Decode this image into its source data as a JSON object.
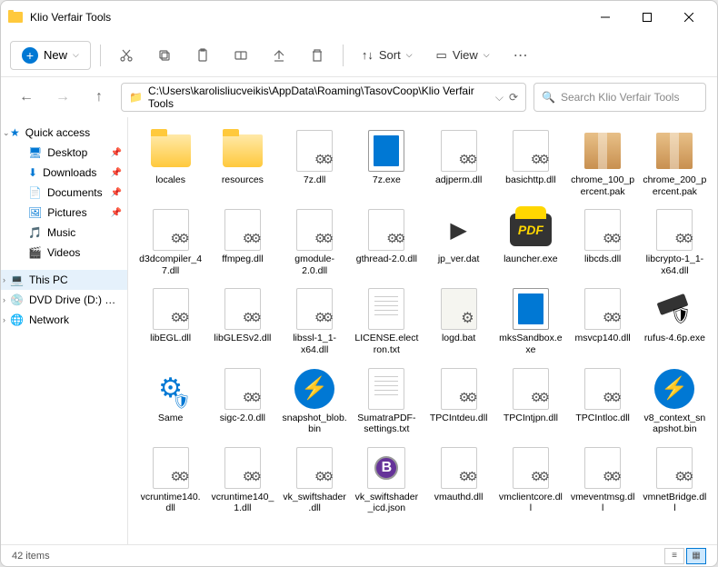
{
  "title": "Klio Verfair Tools",
  "toolbar": {
    "new": "New",
    "sort": "Sort",
    "view": "View"
  },
  "path": "C:\\Users\\karolisliucveikis\\AppData\\Roaming\\TasovCoop\\Klio Verfair Tools",
  "search_placeholder": "Search Klio Verfair Tools",
  "sidebar": {
    "quickaccess": "Quick access",
    "desktop": "Desktop",
    "downloads": "Downloads",
    "documents": "Documents",
    "pictures": "Pictures",
    "music": "Music",
    "videos": "Videos",
    "thispc": "This PC",
    "dvd": "DVD Drive (D:) CCCC",
    "network": "Network"
  },
  "files": [
    {
      "name": "locales",
      "type": "folder"
    },
    {
      "name": "resources",
      "type": "folder"
    },
    {
      "name": "7z.dll",
      "type": "dll"
    },
    {
      "name": "7z.exe",
      "type": "exe-blue"
    },
    {
      "name": "adjperm.dll",
      "type": "dll"
    },
    {
      "name": "basichttp.dll",
      "type": "dll"
    },
    {
      "name": "chrome_100_percent.pak",
      "type": "pak"
    },
    {
      "name": "chrome_200_percent.pak",
      "type": "pak"
    },
    {
      "name": "d3dcompiler_47.dll",
      "type": "dll"
    },
    {
      "name": "ffmpeg.dll",
      "type": "dll"
    },
    {
      "name": "gmodule-2.0.dll",
      "type": "dll"
    },
    {
      "name": "gthread-2.0.dll",
      "type": "dll"
    },
    {
      "name": "jp_ver.dat",
      "type": "play"
    },
    {
      "name": "launcher.exe",
      "type": "pdf"
    },
    {
      "name": "libcds.dll",
      "type": "dll"
    },
    {
      "name": "libcrypto-1_1-x64.dll",
      "type": "dll"
    },
    {
      "name": "libEGL.dll",
      "type": "dll"
    },
    {
      "name": "libGLESv2.dll",
      "type": "dll"
    },
    {
      "name": "libssl-1_1-x64.dll",
      "type": "dll"
    },
    {
      "name": "LICENSE.electron.txt",
      "type": "txt"
    },
    {
      "name": "logd.bat",
      "type": "bat"
    },
    {
      "name": "mksSandbox.exe",
      "type": "exe-blue"
    },
    {
      "name": "msvcp140.dll",
      "type": "dll"
    },
    {
      "name": "rufus-4.6p.exe",
      "type": "usb"
    },
    {
      "name": "Same",
      "type": "gear-shield"
    },
    {
      "name": "sigc-2.0.dll",
      "type": "dll"
    },
    {
      "name": "snapshot_blob.bin",
      "type": "bolt"
    },
    {
      "name": "SumatraPDF-settings.txt",
      "type": "txt"
    },
    {
      "name": "TPCIntdeu.dll",
      "type": "dll"
    },
    {
      "name": "TPCIntjpn.dll",
      "type": "dll"
    },
    {
      "name": "TPCIntloc.dll",
      "type": "dll"
    },
    {
      "name": "v8_context_snapshot.bin",
      "type": "bolt"
    },
    {
      "name": "vcruntime140.dll",
      "type": "dll"
    },
    {
      "name": "vcruntime140_1.dll",
      "type": "dll"
    },
    {
      "name": "vk_swiftshader.dll",
      "type": "dll"
    },
    {
      "name": "vk_swiftshader_icd.json",
      "type": "b"
    },
    {
      "name": "vmauthd.dll",
      "type": "dll"
    },
    {
      "name": "vmclientcore.dll",
      "type": "dll"
    },
    {
      "name": "vmeventmsg.dll",
      "type": "dll"
    },
    {
      "name": "vmnetBridge.dll",
      "type": "dll"
    }
  ],
  "status": "42 items"
}
